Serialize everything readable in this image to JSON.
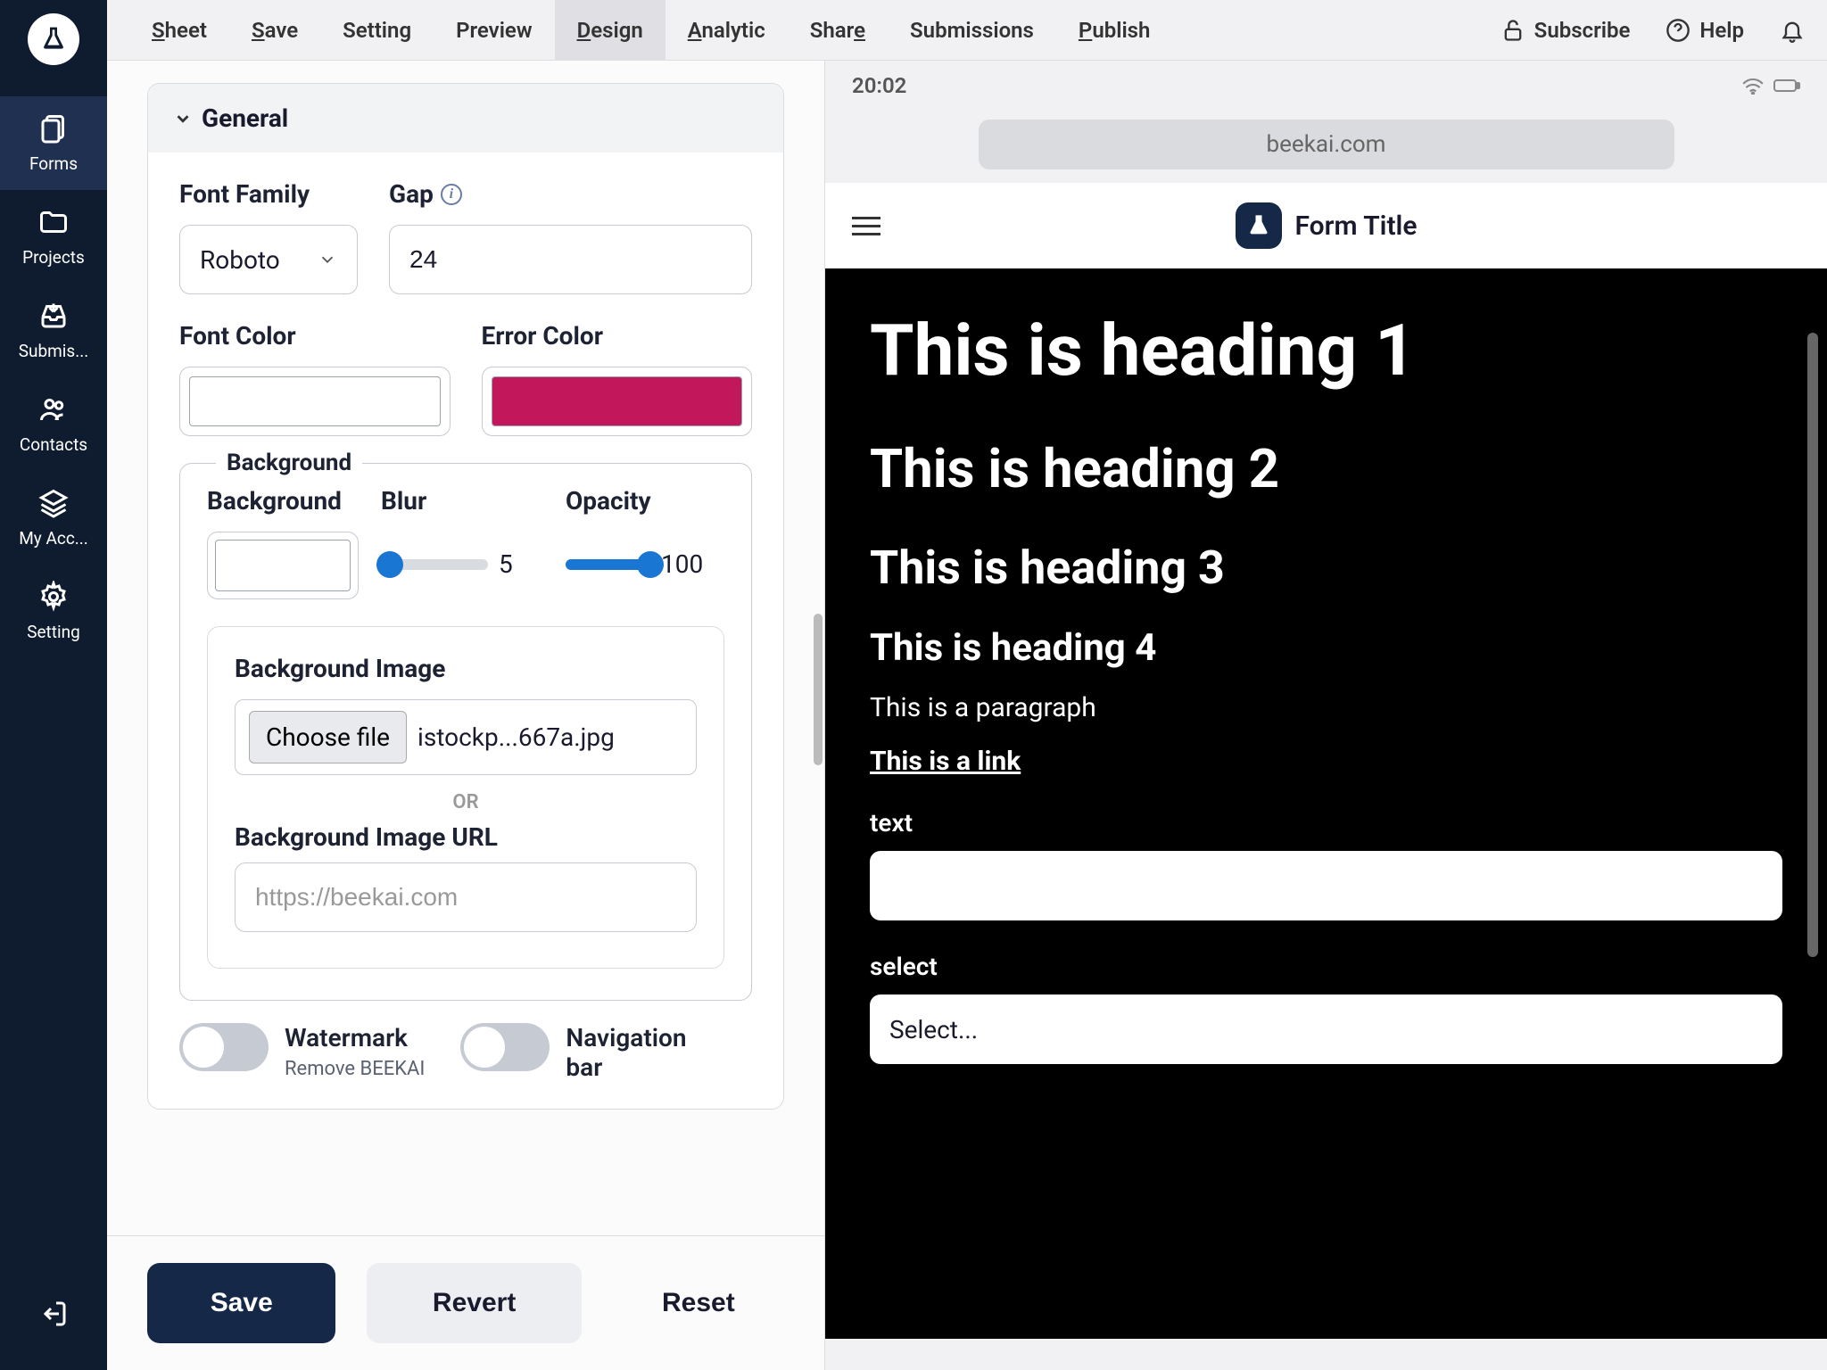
{
  "sidebar": {
    "items": [
      {
        "label": "Forms"
      },
      {
        "label": "Projects"
      },
      {
        "label": "Submis..."
      },
      {
        "label": "Contacts"
      },
      {
        "label": "My Acc..."
      },
      {
        "label": "Setting"
      }
    ]
  },
  "topnav": {
    "items": [
      {
        "prefix": "S",
        "rest": "heet"
      },
      {
        "prefix": "S",
        "rest": "ave"
      },
      {
        "prefix": "",
        "rest": "Setting"
      },
      {
        "prefix": "",
        "rest": "Preview"
      },
      {
        "prefix": "D",
        "rest": "esign"
      },
      {
        "prefix": "A",
        "rest": "nalytic"
      },
      {
        "prefix": "",
        "rest": "Shar",
        "suffix": "e"
      },
      {
        "prefix": "",
        "rest": "Submissions"
      },
      {
        "prefix": "P",
        "rest": "ublish"
      }
    ],
    "subscribe": "Subscribe",
    "help": "Help"
  },
  "design": {
    "general": "General",
    "font_family_label": "Font Family",
    "font_family_value": "Roboto",
    "gap_label": "Gap",
    "gap_value": "24",
    "font_color_label": "Font Color",
    "font_color_value": "#ffffff",
    "error_color_label": "Error Color",
    "error_color_value": "#c2185b",
    "background_legend": "Background",
    "background_label": "Background",
    "background_value": "#ffffff",
    "blur_label": "Blur",
    "blur_value": "5",
    "opacity_label": "Opacity",
    "opacity_value": "100",
    "bg_image_label": "Background Image",
    "choose_file": "Choose file",
    "file_name": "istockp...667a.jpg",
    "or": "OR",
    "bg_url_label": "Background Image URL",
    "bg_url_placeholder": "https://beekai.com",
    "watermark_label": "Watermark",
    "watermark_sub": "Remove BEEKAI",
    "navbar_label": "Navigation bar",
    "save": "Save",
    "revert": "Revert",
    "reset": "Reset"
  },
  "preview": {
    "time": "20:02",
    "domain": "beekai.com",
    "form_title": "Form Title",
    "h1": "This is heading 1",
    "h2": "This is heading 2",
    "h3": "This is heading 3",
    "h4": "This is heading 4",
    "p": "This is a paragraph",
    "link": "This is a link",
    "text_label": "text",
    "select_label": "select",
    "select_value": "Select..."
  }
}
